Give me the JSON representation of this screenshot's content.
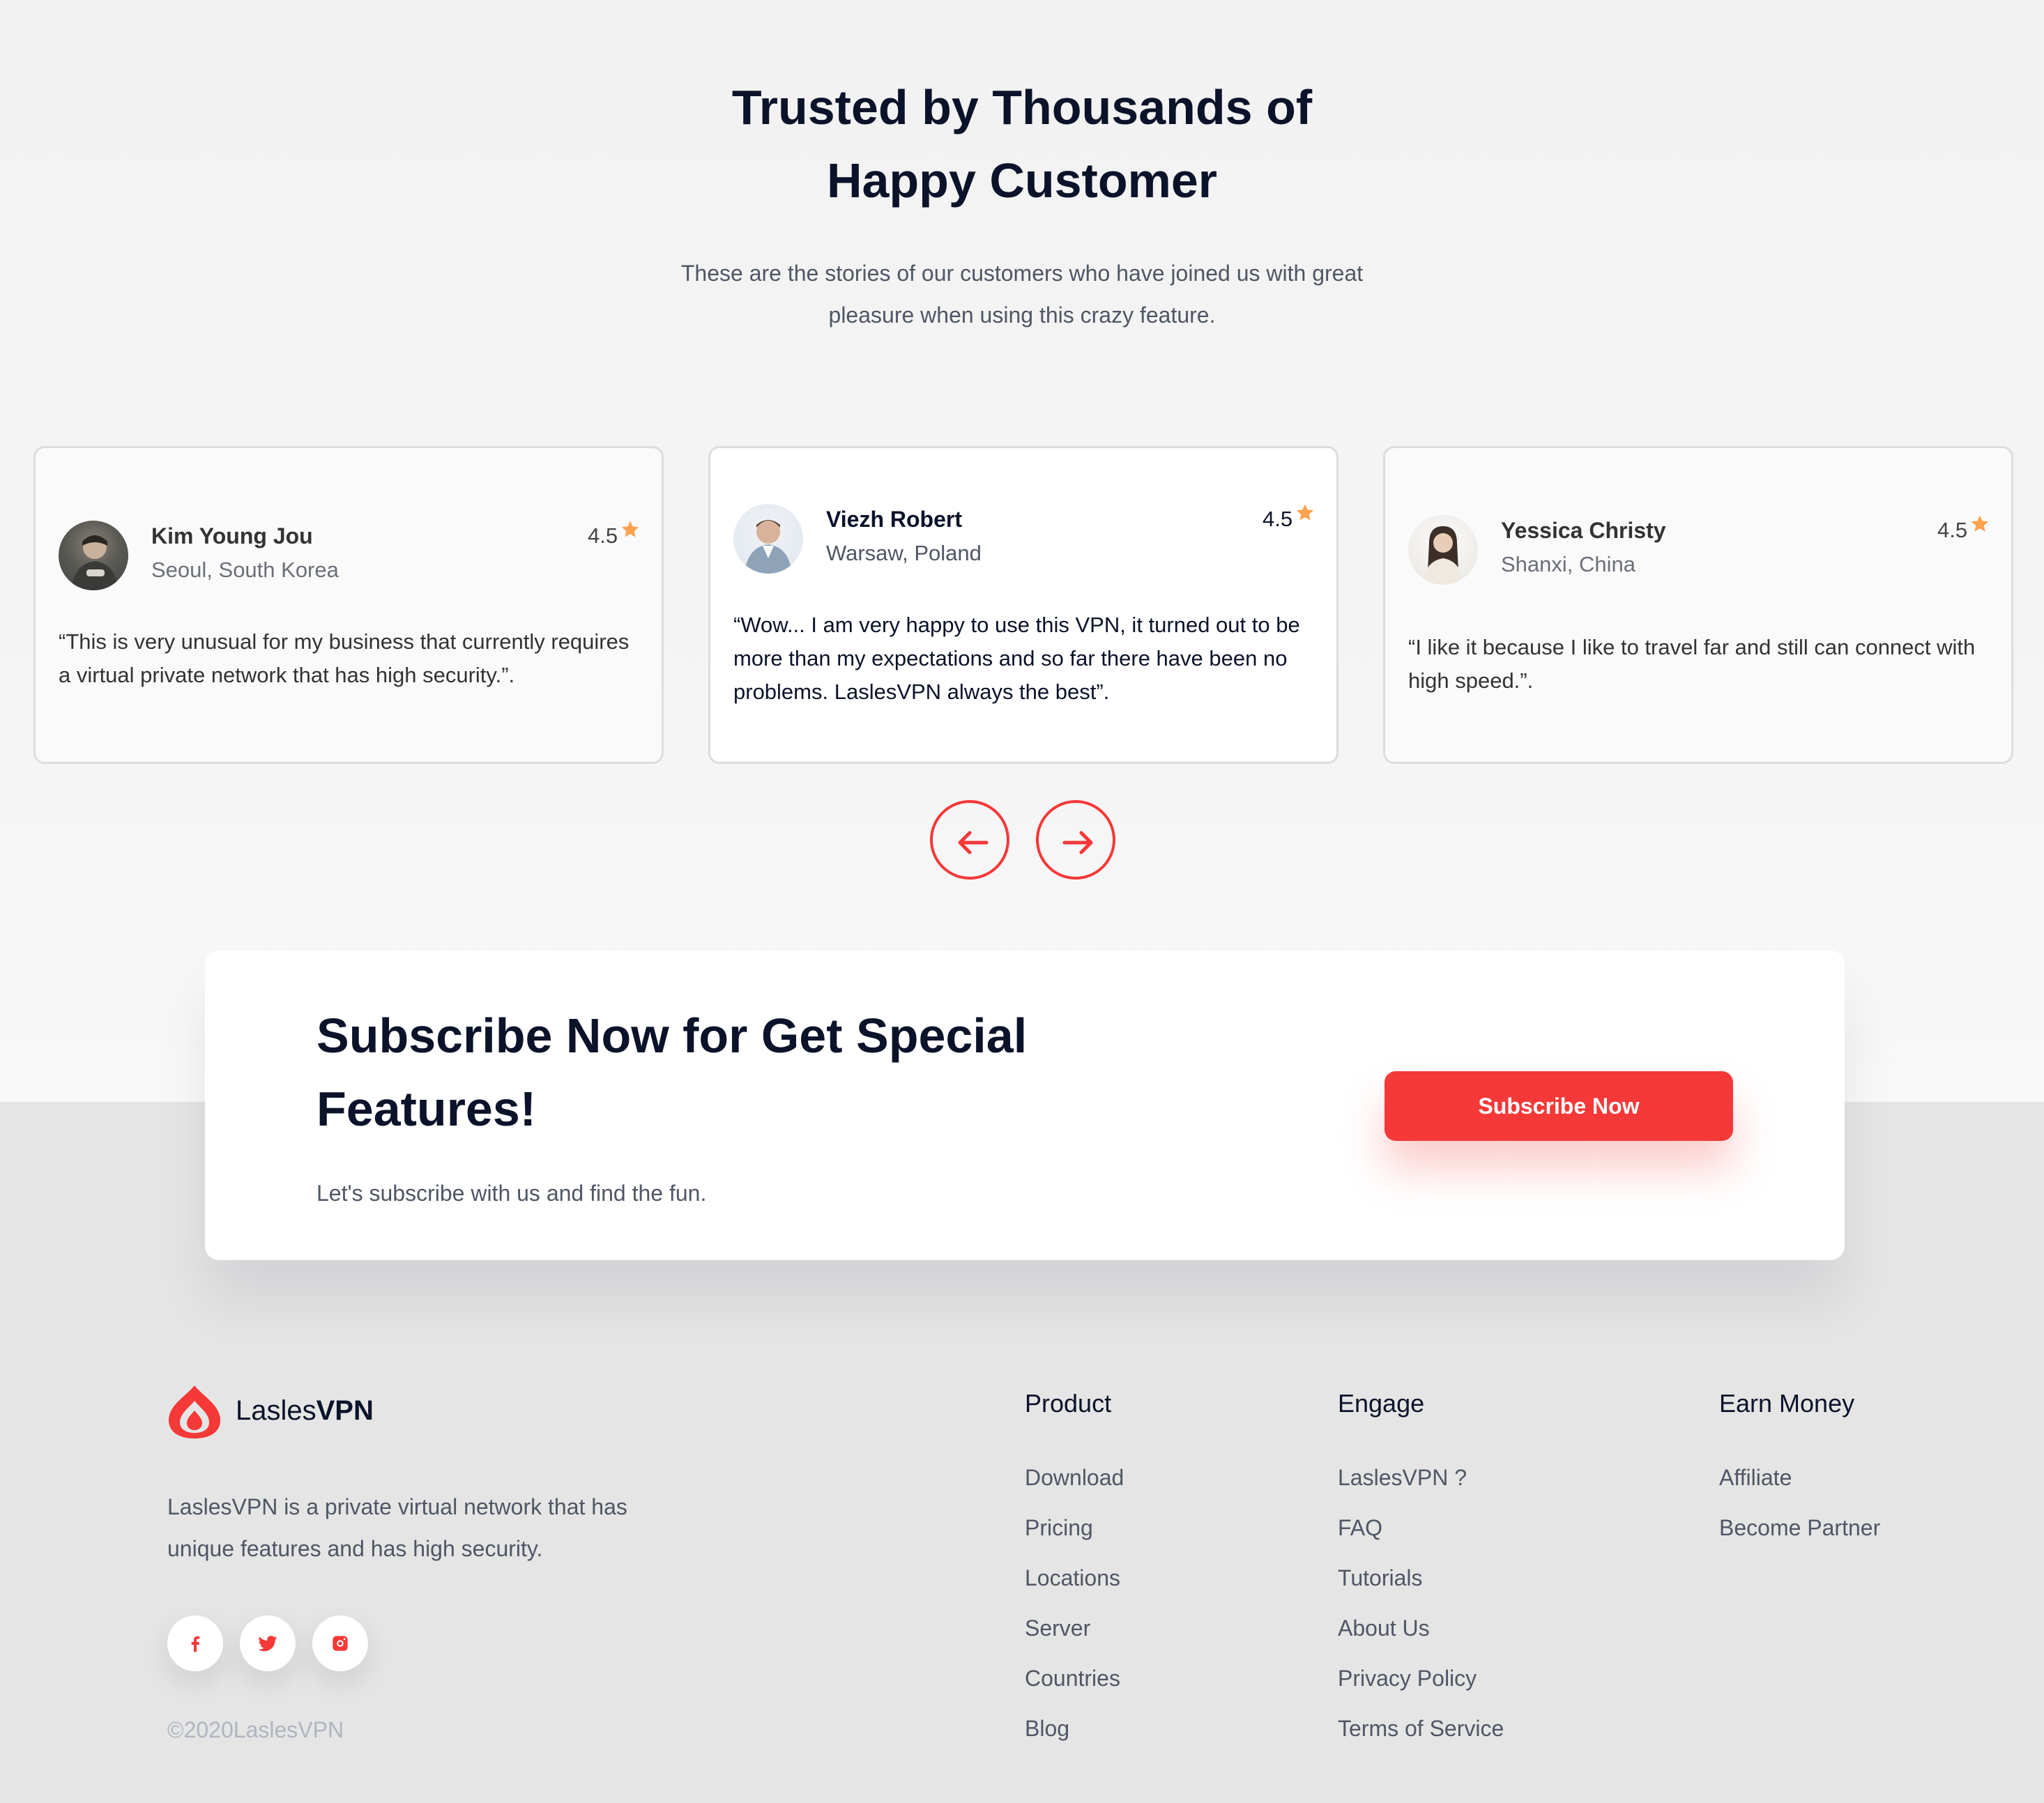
{
  "testimonials": {
    "title_line1": "Trusted by Thousands of",
    "title_line2": "Happy Customer",
    "subtitle": "These are the stories of our customers who have joined us with great pleasure when using this crazy feature.",
    "cards": [
      {
        "name": "Kim Young Jou",
        "location": "Seoul, South Korea",
        "rating": "4.5",
        "quote": "“This is very unusual for my business that currently requires a virtual private network that has high security.”."
      },
      {
        "name": "Viezh Robert",
        "location": "Warsaw, Poland",
        "rating": "4.5",
        "quote": "“Wow... I am very happy to use this VPN, it turned out to be more than my expectations and so far there have been no problems. LaslesVPN always the best”."
      },
      {
        "name": "Yessica Christy",
        "location": "Shanxi, China",
        "rating": "4.5",
        "quote": "“I like it because I like to travel far and still can connect with high speed.”."
      }
    ],
    "star_color": "#fea250"
  },
  "subscribe": {
    "title": "Subscribe Now for Get Special Features!",
    "text": "Let's subscribe with us and find the fun.",
    "button_label": "Subscribe Now",
    "accent_color": "#f53838"
  },
  "footer": {
    "brand_light": "Lasles",
    "brand_bold": "VPN",
    "description": "LaslesVPN is a private virtual network that has unique features and has high security.",
    "copyright": "©2020LaslesVPN",
    "social_icons": [
      "facebook-icon",
      "twitter-icon",
      "instagram-icon"
    ],
    "columns": [
      {
        "title": "Product",
        "links": [
          "Download",
          "Pricing",
          "Locations",
          "Server",
          "Countries",
          "Blog"
        ]
      },
      {
        "title": "Engage",
        "links": [
          "LaslesVPN ?",
          "FAQ",
          "Tutorials",
          "About Us",
          "Privacy Policy",
          "Terms of Service"
        ]
      },
      {
        "title": "Earn Money",
        "links": [
          "Affiliate",
          "Become Partner"
        ]
      }
    ]
  }
}
